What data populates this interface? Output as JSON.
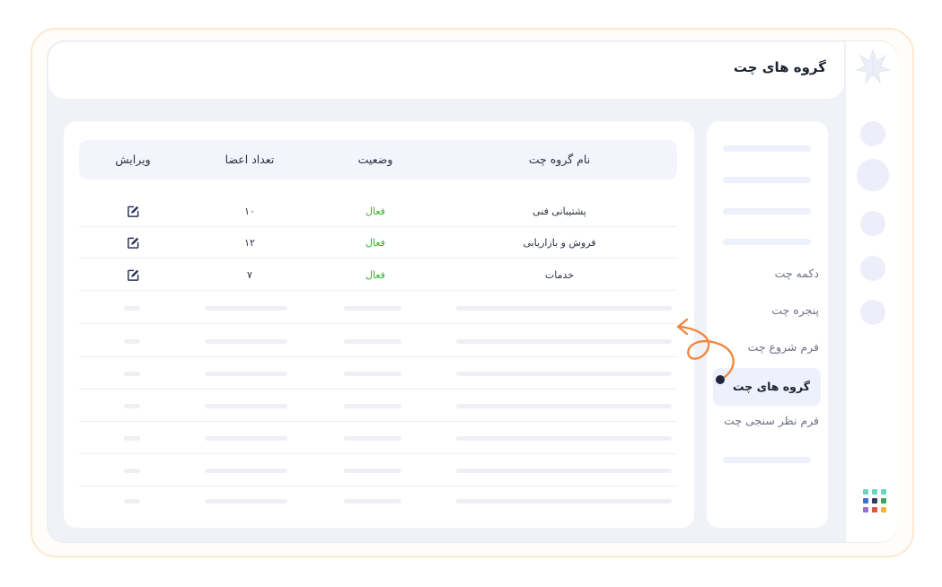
{
  "header": {
    "title": "گروه های چت"
  },
  "menu": {
    "items": [
      {
        "label": "دکمه چت",
        "active": false
      },
      {
        "label": "پنجره چت",
        "active": false
      },
      {
        "label": "فرم شروع چت",
        "active": false
      },
      {
        "label": "گروه های چت",
        "active": true
      },
      {
        "label": "فرم نظر سنجی چت",
        "active": false
      }
    ]
  },
  "table": {
    "columns": {
      "name": "نام گروه چت",
      "status": "وضعیت",
      "members": "تعداد اعضا",
      "edit": "ویرایش"
    },
    "rows": [
      {
        "name": "پشتیبانی فنی",
        "status": "فعال",
        "members": "۱۰"
      },
      {
        "name": "فروش و بازاریابی",
        "status": "فعال",
        "members": "۱۲"
      },
      {
        "name": "خدمات",
        "status": "فعال",
        "members": "۷"
      }
    ]
  },
  "icons": {
    "edit": "edit-icon",
    "logo": "leaf-logo-icon",
    "apps": "apps-grid-icon"
  },
  "colors": {
    "accent_arrow": "#f0883e",
    "status_active": "#2eb22e",
    "active_bg": "#eef0fb",
    "title": "#1d2333"
  }
}
